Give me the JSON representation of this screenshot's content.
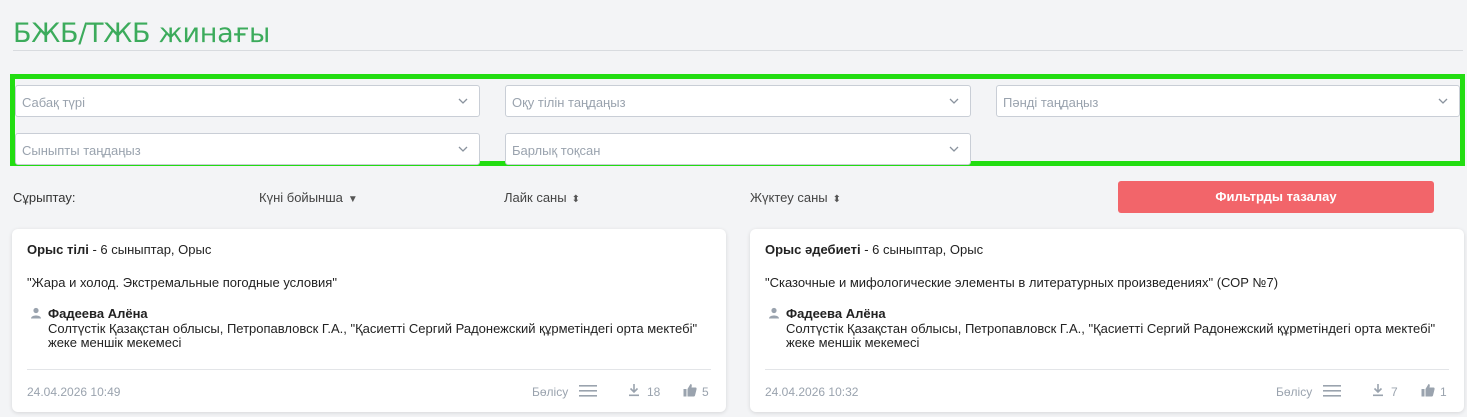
{
  "page": {
    "title": "БЖБ/ТЖБ жинағы"
  },
  "filters": {
    "lesson_type": "Сабақ түрі",
    "language": "Оқу тілін таңдаңыз",
    "subject": "Пәнді таңдаңыз",
    "grade": "Сыныпты таңдаңыз",
    "quarter": "Барлық тоқсан"
  },
  "sort": {
    "label": "Сұрыптау:",
    "by_date": "Күні бойынша",
    "by_likes": "Лайк саны",
    "by_downloads": "Жүктеу саны",
    "clear_button": "Фильтрды тазалау"
  },
  "cards": [
    {
      "subject": "Орыс тілі",
      "meta": " - 6 сыныптар, Орыс",
      "topic": "\"Жара и холод. Экстремальные погодные условия\"",
      "author": "Фадеева Алёна",
      "school": "Солтүстік Қазақстан облысы, Петропавловск Г.А., \"Қасиетті Сергий Радонежский құрметіндегі орта мектебі\" жеке меншік мекемесі",
      "date": "24.04.2026 10:49",
      "share_label": "Бөлісу",
      "downloads": "18",
      "likes": "5"
    },
    {
      "subject": "Орыс әдебиеті",
      "meta": " - 6 сыныптар, Орыс",
      "topic": "\"Сказочные и мифологические элементы в литературных произведениях\" (СОР №7)",
      "author": "Фадеева Алёна",
      "school": "Солтүстік Қазақстан облысы, Петропавловск Г.А., \"Қасиетті Сергий Радонежский құрметіндегі орта мектебі\" жеке меншік мекемесі",
      "date": "24.04.2026 10:32",
      "share_label": "Бөлісу",
      "downloads": "7",
      "likes": "1"
    }
  ],
  "colors": {
    "title": "#3cab5c",
    "highlight_border": "#22dd11",
    "clear_button": "#f2656a"
  }
}
